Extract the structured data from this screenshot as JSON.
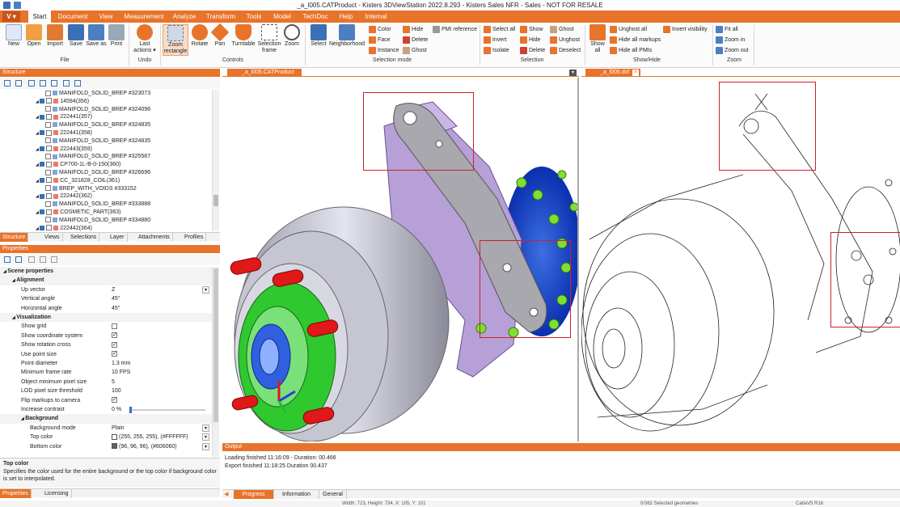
{
  "window": {
    "title": "_a_l005.CATProduct - Kisters 3DViewStation 2022.8.293 - Kisters Sales NFR - Sales - NOT FOR RESALE"
  },
  "menu": {
    "app_button": "V",
    "tabs": [
      "Start",
      "Document",
      "View",
      "Measurement",
      "Analyze",
      "Transform",
      "Tools",
      "Model",
      "TechDoc",
      "Help",
      "Internal"
    ]
  },
  "ribbon": {
    "file": {
      "group": "File",
      "new": "New",
      "open": "Open",
      "import": "Import",
      "save": "Save",
      "save_as": "Save as",
      "print": "Print"
    },
    "undo": {
      "group": "Undo",
      "last_actions": "Last actions"
    },
    "controls": {
      "group": "Controls",
      "zoom_rect": "Zoom rectangle",
      "rotate": "Rotate",
      "pan": "Pan",
      "turntable": "Turntable",
      "selection_frame": "Selection frame",
      "zoom": "Zoom"
    },
    "selection_mode": {
      "group": "Selection mode",
      "select": "Select",
      "neighborhood": "Neighborhood",
      "color": "Color",
      "face": "Face",
      "instance": "Instance",
      "hide": "Hide",
      "delete": "Delete",
      "ghost": "Ghost",
      "pmi_reference": "PMI reference"
    },
    "selection": {
      "group": "Selection",
      "select_all": "Select all",
      "invert": "Invert",
      "isolate": "Isolate",
      "show": "Show",
      "hide": "Hide",
      "delete": "Delete",
      "ghost": "Ghost",
      "unghost": "Unghost",
      "deselect": "Deselect"
    },
    "show_hide": {
      "group": "Show/Hide",
      "show_all": "Show all",
      "unghost_all": "Unghost all",
      "hide_all_markups": "Hide all markups",
      "hide_all_pmis": "Hide all PMIs",
      "invert_visibility": "Invert visibility"
    },
    "zoom": {
      "group": "Zoom",
      "fit_all": "Fit all",
      "zoom_in": "Zoom in",
      "zoom_out": "Zoom out"
    }
  },
  "structure": {
    "title": "Structure",
    "rows": [
      {
        "label": "MANIFOLD_SOLID_BREP #323073",
        "level": 2
      },
      {
        "label": "14594(356)",
        "level": 1
      },
      {
        "label": "MANIFOLD_SOLID_BREP #324096",
        "level": 2
      },
      {
        "label": "222441(357)",
        "level": 1
      },
      {
        "label": "MANIFOLD_SOLID_BREP #324835",
        "level": 2
      },
      {
        "label": "222441(358)",
        "level": 1
      },
      {
        "label": "MANIFOLD_SOLID_BREP #324835",
        "level": 2
      },
      {
        "label": "222443(359)",
        "level": 1
      },
      {
        "label": "MANIFOLD_SOLID_BREP #325587",
        "level": 2
      },
      {
        "label": "CP700-1L-B-0-150(360)",
        "level": 1
      },
      {
        "label": "MANIFOLD_SOLID_BREP #326696",
        "level": 2
      },
      {
        "label": "CC_321828_COIL(361)",
        "level": 1
      },
      {
        "label": "BREP_WITH_VOIDS #333152",
        "level": 2
      },
      {
        "label": "222442(362)",
        "level": 1
      },
      {
        "label": "MANIFOLD_SOLID_BREP #333888",
        "level": 2
      },
      {
        "label": "COSMETIC_PART(363)",
        "level": 1
      },
      {
        "label": "MANIFOLD_SOLID_BREP #334880",
        "level": 2
      },
      {
        "label": "222442(364)",
        "level": 1
      }
    ],
    "tabs": [
      "Structure",
      "Views",
      "Selections",
      "Layer",
      "Attachments",
      "Profiles"
    ]
  },
  "properties": {
    "title": "Properties",
    "rows": [
      {
        "label": "Scene properties",
        "value": "",
        "kind": "section",
        "indent": 0
      },
      {
        "label": "Alignment",
        "value": "",
        "kind": "section",
        "indent": 1
      },
      {
        "label": "Up vector",
        "value": "Z",
        "kind": "dropdown",
        "indent": 2
      },
      {
        "label": "Vertical angle",
        "value": "45°",
        "kind": "text",
        "indent": 2
      },
      {
        "label": "Horizontal angle",
        "value": "45°",
        "kind": "text",
        "indent": 2
      },
      {
        "label": "Visualization",
        "value": "",
        "kind": "section",
        "indent": 1
      },
      {
        "label": "Show grid",
        "value": "",
        "kind": "check-off",
        "indent": 2
      },
      {
        "label": "Show coordinate system",
        "value": "",
        "kind": "check-on",
        "indent": 2
      },
      {
        "label": "Show rotation cross",
        "value": "",
        "kind": "check-on",
        "indent": 2
      },
      {
        "label": "Use point size",
        "value": "",
        "kind": "check-on",
        "indent": 2
      },
      {
        "label": "Point diameter",
        "value": "1.3 mm",
        "kind": "text",
        "indent": 2
      },
      {
        "label": "Minimum frame rate",
        "value": "10 FPS",
        "kind": "text",
        "indent": 2
      },
      {
        "label": "Object minimum pixel size",
        "value": "5",
        "kind": "text",
        "indent": 2
      },
      {
        "label": "LOD pixel size threshold",
        "value": "100",
        "kind": "text",
        "indent": 2
      },
      {
        "label": "Flip markups to camera",
        "value": "",
        "kind": "check-on",
        "indent": 2
      },
      {
        "label": "Increase contrast",
        "value": "0 %",
        "kind": "slider",
        "indent": 2
      },
      {
        "label": "Background",
        "value": "",
        "kind": "section",
        "indent": 2
      },
      {
        "label": "Background mode",
        "value": "Plain",
        "kind": "dropdown",
        "indent": 3
      },
      {
        "label": "Top color",
        "value": "(255, 255, 255), (#FFFFFF)",
        "kind": "color-white",
        "indent": 3
      },
      {
        "label": "Bottom color",
        "value": "(96, 96, 96), (#606060)",
        "kind": "color-gray",
        "indent": 3
      }
    ],
    "help_title": "Top color",
    "help_text": "Specifies the color used for the entire background or the top color if background color is set to interpolated.",
    "tabs": [
      "Properties",
      "Licensing"
    ]
  },
  "viewports": {
    "left_tab": "_a_l005.CATProduct",
    "right_tab": "_a_l005.dxf"
  },
  "output": {
    "title": "Output",
    "lines": [
      "Loading finished 11:16:09 - Duration: 00.466",
      "Export finished 11:18:25 Duration 00.437"
    ],
    "tabs": [
      "Progress",
      "Information",
      "General"
    ]
  },
  "status": {
    "dims": "Width: 723, Height: 734, X: 105, Y: 101",
    "selected": "0/362 Selected geometries",
    "format": "CatiaV5 R16"
  },
  "colors": {
    "accent": "#e8732a",
    "accent_dark": "#c9541a",
    "selection_box": "#d0202a"
  }
}
